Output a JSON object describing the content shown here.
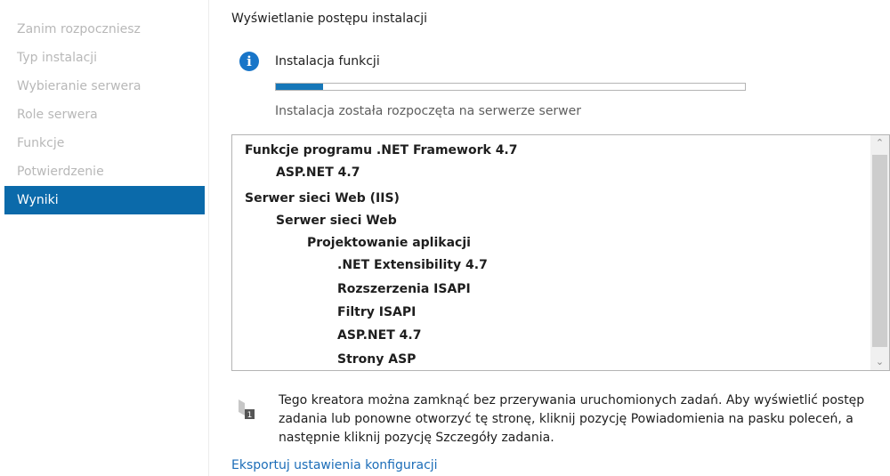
{
  "sidebar": {
    "items": [
      {
        "label": "Zanim rozpoczniesz"
      },
      {
        "label": "Typ instalacji"
      },
      {
        "label": "Wybieranie serwera"
      },
      {
        "label": "Role serwera"
      },
      {
        "label": "Funkcje"
      },
      {
        "label": "Potwierdzenie"
      },
      {
        "label": "Wyniki"
      }
    ],
    "active_index": 6
  },
  "main": {
    "title": "Wyświetlanie postępu instalacji",
    "status": {
      "icon": "info-icon",
      "label": "Instalacja funkcji",
      "progress_fraction": 0.1,
      "detail": "Instalacja została rozpoczęta na serwerze serwer"
    },
    "results": {
      "items": [
        {
          "text": "Funkcje programu .NET Framework 4.7",
          "level": 0
        },
        {
          "text": "ASP.NET 4.7",
          "level": 1
        },
        {
          "text": "Serwer sieci Web (IIS)",
          "level": 0
        },
        {
          "text": "Serwer sieci Web",
          "level": 1
        },
        {
          "text": "Projektowanie aplikacji",
          "level": 2
        },
        {
          "text": ".NET Extensibility 4.7",
          "level": 3
        },
        {
          "text": "Rozszerzenia ISAPI",
          "level": 3
        },
        {
          "text": "Filtry ISAPI",
          "level": 3
        },
        {
          "text": "ASP.NET 4.7",
          "level": 3
        },
        {
          "text": "Strony ASP",
          "level": 3
        }
      ]
    },
    "notice": {
      "icon": "flag-notification-icon",
      "badge": "1",
      "text": "Tego kreatora można zamknąć bez przerywania uruchomionych zadań. Aby wyświetlić postęp zadania lub ponowne otworzyć tę stronę, kliknij pozycję Powiadomienia na pasku poleceń, a następnie kliknij pozycję Szczegóły zadania."
    },
    "export_link": "Eksportuj ustawienia konfiguracji"
  },
  "colors": {
    "accent": "#0b6aaa",
    "link": "#1c6db8",
    "progress": "#1677b8"
  }
}
